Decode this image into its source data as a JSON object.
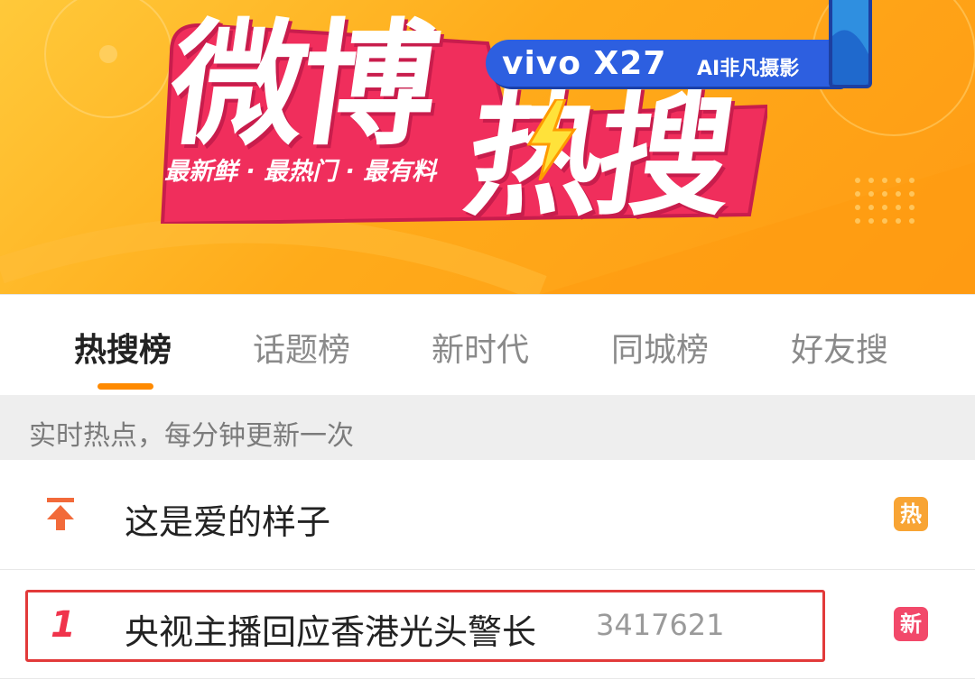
{
  "banner": {
    "title_part1": "微博",
    "title_part2": "热搜",
    "slogan": "最新鲜 · 最热门 · 最有料",
    "ad_brand": "vivo X27",
    "ad_tagline": "AI非凡摄影"
  },
  "tabs": [
    {
      "label": "热搜榜",
      "active": true
    },
    {
      "label": "话题榜",
      "active": false
    },
    {
      "label": "新时代",
      "active": false
    },
    {
      "label": "同城榜",
      "active": false
    },
    {
      "label": "好友搜",
      "active": false
    }
  ],
  "notice": "实时热点，每分钟更新一次",
  "list": {
    "pinned": {
      "title": "这是爱的样子",
      "badge": "热",
      "badge_color": "#f8a434",
      "icon": "pin-top-arrow-icon"
    },
    "items": [
      {
        "rank": "1",
        "title": "央视主播回应香港光头警长",
        "count": "3417621",
        "badge": "新",
        "badge_color": "#f2496a"
      }
    ]
  },
  "colors": {
    "accent_orange": "#ff8a00",
    "banner_pink": "#f02e5c",
    "rank_red": "#f0334b",
    "highlight_red": "#e23a3a"
  }
}
